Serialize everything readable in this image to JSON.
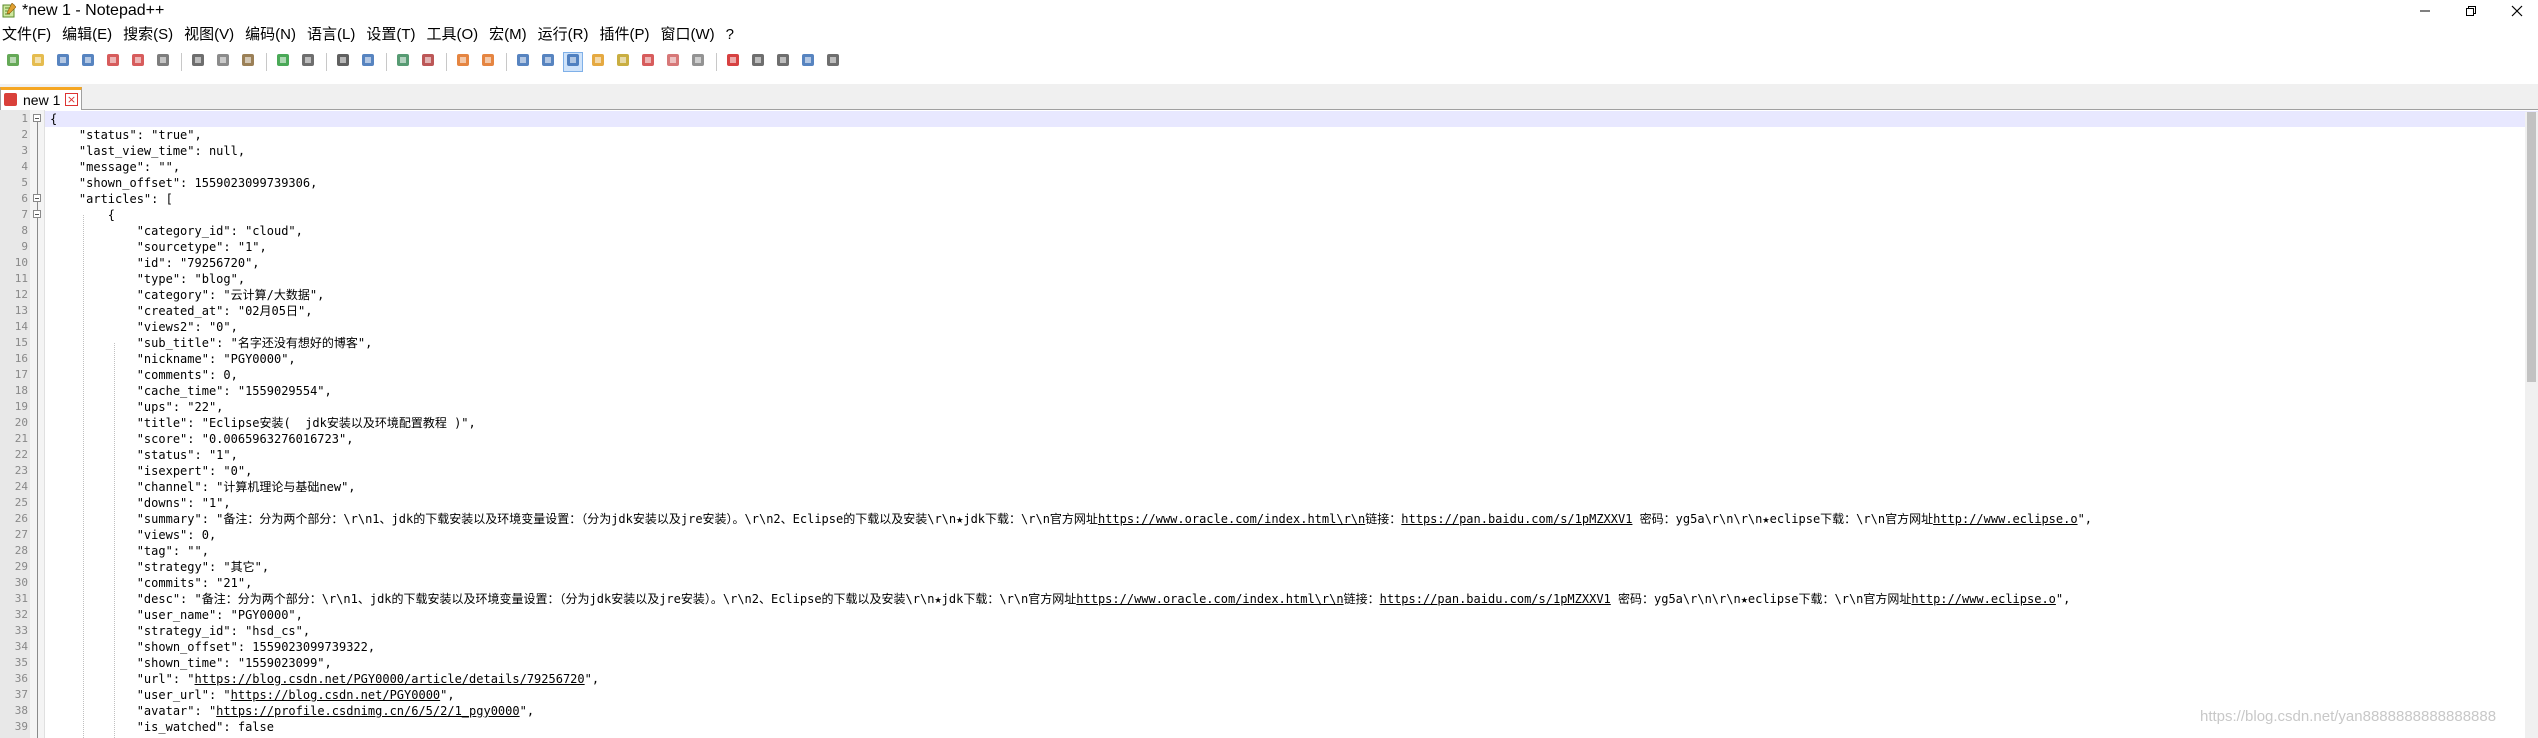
{
  "window": {
    "title": "*new 1 - Notepad++",
    "icon": "notepadpp-icon",
    "controls": [
      "minimize-icon",
      "maximize-icon",
      "close-icon"
    ]
  },
  "menu": [
    {
      "label": "文件(F)"
    },
    {
      "label": "编辑(E)"
    },
    {
      "label": "搜索(S)"
    },
    {
      "label": "视图(V)"
    },
    {
      "label": "编码(N)"
    },
    {
      "label": "语言(L)"
    },
    {
      "label": "设置(T)"
    },
    {
      "label": "工具(O)"
    },
    {
      "label": "宏(M)"
    },
    {
      "label": "运行(R)"
    },
    {
      "label": "插件(P)"
    },
    {
      "label": "窗口(W)"
    },
    {
      "label": "?"
    }
  ],
  "toolbar": [
    {
      "icon": "new-file-icon",
      "color": "#4a9a3a"
    },
    {
      "icon": "open-file-icon",
      "color": "#e0b030"
    },
    {
      "icon": "save-icon",
      "color": "#3a6fb5"
    },
    {
      "icon": "save-all-icon",
      "color": "#3a6fb5"
    },
    {
      "icon": "close-file-icon",
      "color": "#d04040"
    },
    {
      "icon": "close-all-icon",
      "color": "#d04040"
    },
    {
      "icon": "print-icon",
      "color": "#666666"
    },
    {
      "sep": true
    },
    {
      "icon": "cut-icon",
      "color": "#555555"
    },
    {
      "icon": "copy-icon",
      "color": "#777777"
    },
    {
      "icon": "paste-icon",
      "color": "#8a6a3a"
    },
    {
      "sep": true
    },
    {
      "icon": "undo-icon",
      "color": "#2a9a3a"
    },
    {
      "icon": "redo-icon",
      "color": "#555555"
    },
    {
      "sep": true
    },
    {
      "icon": "find-icon",
      "color": "#444444"
    },
    {
      "icon": "replace-icon",
      "color": "#3a6fb5"
    },
    {
      "sep": true
    },
    {
      "icon": "zoom-in-icon",
      "color": "#3a8a5a"
    },
    {
      "icon": "zoom-out-icon",
      "color": "#b03a3a"
    },
    {
      "sep": true
    },
    {
      "icon": "sync-vertical-icon",
      "color": "#e07020"
    },
    {
      "icon": "sync-horizontal-icon",
      "color": "#e07020"
    },
    {
      "sep": true
    },
    {
      "icon": "word-wrap-icon",
      "color": "#3a6fb5"
    },
    {
      "icon": "show-all-chars-icon",
      "color": "#3a6fb5"
    },
    {
      "icon": "indent-guide-icon",
      "color": "#3a6fb5",
      "active": true
    },
    {
      "icon": "define-language-icon",
      "color": "#e09a20"
    },
    {
      "icon": "doc-map-icon",
      "color": "#c0a020"
    },
    {
      "icon": "function-list-icon",
      "color": "#d04040"
    },
    {
      "icon": "folder-workspace-icon",
      "color": "#d06060"
    },
    {
      "icon": "monitoring-icon",
      "color": "#808080"
    },
    {
      "sep": true
    },
    {
      "icon": "record-macro-icon",
      "color": "#d02020"
    },
    {
      "icon": "stop-record-icon",
      "color": "#555555"
    },
    {
      "icon": "play-macro-icon",
      "color": "#555555"
    },
    {
      "icon": "run-macro-multiple-icon",
      "color": "#3a6fb5"
    },
    {
      "icon": "save-macro-icon",
      "color": "#555555"
    }
  ],
  "tabs": [
    {
      "label": "new 1",
      "modified": true
    }
  ],
  "editor": {
    "lines": [
      [
        {
          "t": "{"
        }
      ],
      [
        {
          "t": "    \"status\": \"true\","
        }
      ],
      [
        {
          "t": "    \"last_view_time\": null,"
        }
      ],
      [
        {
          "t": "    \"message\": \"\","
        }
      ],
      [
        {
          "t": "    \"shown_offset\": 1559023099739306,"
        }
      ],
      [
        {
          "t": "    \"articles\": ["
        }
      ],
      [
        {
          "t": "        {"
        }
      ],
      [
        {
          "t": "            \"category_id\": \"cloud\","
        }
      ],
      [
        {
          "t": "            \"sourcetype\": \"1\","
        }
      ],
      [
        {
          "t": "            \"id\": \"79256720\","
        }
      ],
      [
        {
          "t": "            \"type\": \"blog\","
        }
      ],
      [
        {
          "t": "            \"category\": \"云计算/大数据\","
        }
      ],
      [
        {
          "t": "            \"created_at\": \"02月05日\","
        }
      ],
      [
        {
          "t": "            \"views2\": \"0\","
        }
      ],
      [
        {
          "t": "            \"sub_title\": \"名字还没有想好的博客\","
        }
      ],
      [
        {
          "t": "            \"nickname\": \"PGY0000\","
        }
      ],
      [
        {
          "t": "            \"comments\": 0,"
        }
      ],
      [
        {
          "t": "            \"cache_time\": \"1559029554\","
        }
      ],
      [
        {
          "t": "            \"ups\": \"22\","
        }
      ],
      [
        {
          "t": "            \"title\": \"Eclipse安装(  jdk安装以及环境配置教程 )\","
        }
      ],
      [
        {
          "t": "            \"score\": \"0.0065963276016723\","
        }
      ],
      [
        {
          "t": "            \"status\": \"1\","
        }
      ],
      [
        {
          "t": "            \"isexpert\": \"0\","
        }
      ],
      [
        {
          "t": "            \"channel\": \"计算机理论与基础new\","
        }
      ],
      [
        {
          "t": "            \"downs\": \"1\","
        }
      ],
      [
        {
          "t": "            \"summary\": \"备注：分为两个部分：\\r\\n1、jdk的下载安装以及环境变量设置：（分为jdk安装以及jre安装）。\\r\\n2、Eclipse的下载以及安装\\r\\n★jdk下载：\\r\\n官方网址"
        },
        {
          "t": "https://www.oracle.com/index.html\\r\\n",
          "link": true
        },
        {
          "t": "链接："
        },
        {
          "t": "https://pan.baidu.com/s/1pMZXXV1",
          "link": true
        },
        {
          "t": " 密码：yg5a\\r\\n\\r\\n★eclipse下载：\\r\\n官方网址"
        },
        {
          "t": "http://www.eclipse.o",
          "link": true
        },
        {
          "t": "\","
        }
      ],
      [
        {
          "t": "            \"views\": 0,"
        }
      ],
      [
        {
          "t": "            \"tag\": \"\","
        }
      ],
      [
        {
          "t": "            \"strategy\": \"其它\","
        }
      ],
      [
        {
          "t": "            \"commits\": \"21\","
        }
      ],
      [
        {
          "t": "            \"desc\": \"备注：分为两个部分：\\r\\n1、jdk的下载安装以及环境变量设置：（分为jdk安装以及jre安装）。\\r\\n2、Eclipse的下载以及安装\\r\\n★jdk下载：\\r\\n官方网址"
        },
        {
          "t": "https://www.oracle.com/index.html\\r\\n",
          "link": true
        },
        {
          "t": "链接："
        },
        {
          "t": "https://pan.baidu.com/s/1pMZXXV1",
          "link": true
        },
        {
          "t": " 密码：yg5a\\r\\n\\r\\n★eclipse下载：\\r\\n官方网址"
        },
        {
          "t": "http://www.eclipse.o",
          "link": true
        },
        {
          "t": "\","
        }
      ],
      [
        {
          "t": "            \"user_name\": \"PGY0000\","
        }
      ],
      [
        {
          "t": "            \"strategy_id\": \"hsd_cs\","
        }
      ],
      [
        {
          "t": "            \"shown_offset\": 1559023099739322,"
        }
      ],
      [
        {
          "t": "            \"shown_time\": \"1559023099\","
        }
      ],
      [
        {
          "t": "            \"url\": \""
        },
        {
          "t": "https://blog.csdn.net/PGY0000/article/details/79256720",
          "link": true
        },
        {
          "t": "\","
        }
      ],
      [
        {
          "t": "            \"user_url\": \""
        },
        {
          "t": "https://blog.csdn.net/PGY0000",
          "link": true
        },
        {
          "t": "\","
        }
      ],
      [
        {
          "t": "            \"avatar\": \""
        },
        {
          "t": "https://profile.csdnimg.cn/6/5/2/1_pgy0000",
          "link": true
        },
        {
          "t": "\","
        }
      ],
      [
        {
          "t": "            \"is_watched\": false"
        }
      ]
    ]
  },
  "watermark": "https://blog.csdn.net/yan8888888888888888"
}
